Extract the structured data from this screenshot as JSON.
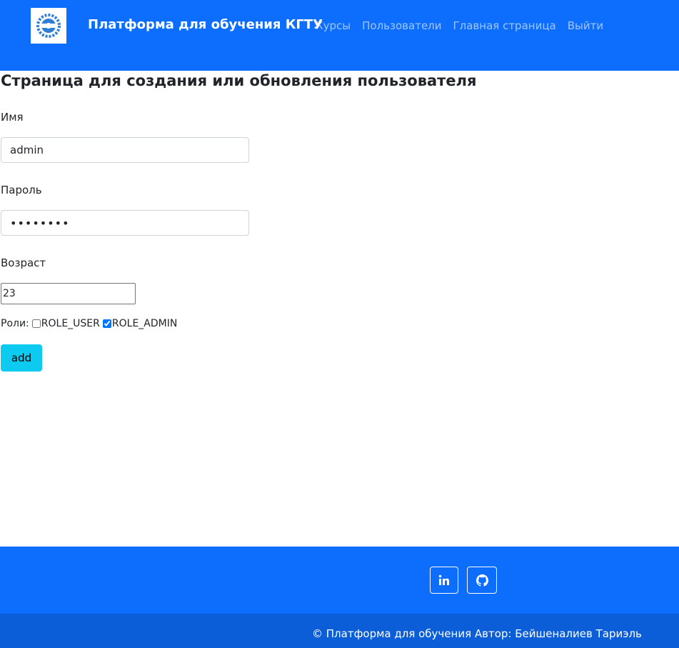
{
  "navbar": {
    "brand": "Платформа для обучения КГТУ",
    "links": [
      "Курсы",
      "Пользователи",
      "Главная страница",
      "Выйти"
    ],
    "logo_icon": "university-gear-logo",
    "background": "#0d6efd"
  },
  "form": {
    "title": "Страница для создания или обновления пользователя",
    "name_label": "Имя",
    "name_value": "admin",
    "password_label": "Пароль",
    "password_value": "••••••••",
    "age_label": "Возраст",
    "age_value": "23",
    "roles_label": "Роли:",
    "roles": [
      {
        "label": "ROLE_USER",
        "checked": false
      },
      {
        "label": "ROLE_ADMIN",
        "checked": true
      }
    ],
    "submit_label": "add",
    "submit_color": "#0dcaf0"
  },
  "footer": {
    "social_icons": [
      "linkedin-icon",
      "github-icon"
    ],
    "copyright": "© Платформа для обучения Автор: Бейшеналиев Тариэль",
    "top_color": "#0d6efd",
    "bottom_color": "#0b5ed7"
  }
}
